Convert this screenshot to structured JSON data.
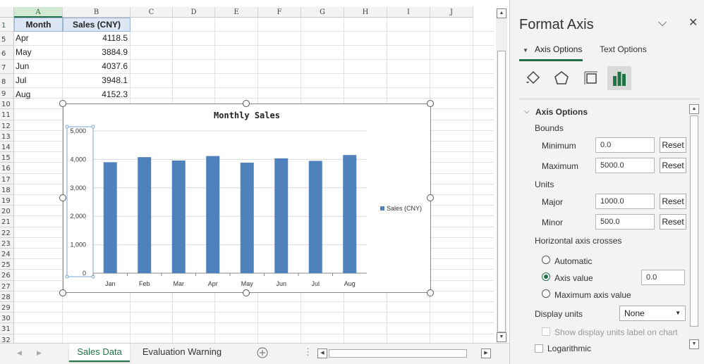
{
  "sheet": {
    "columns": [
      "A",
      "B",
      "C",
      "D",
      "E",
      "F",
      "G",
      "H",
      "I",
      "J"
    ],
    "rows": [
      "1",
      "5",
      "6",
      "7",
      "8",
      "9",
      "10",
      "11",
      "12",
      "13",
      "14",
      "15",
      "16",
      "17",
      "18",
      "19",
      "20",
      "21",
      "22",
      "23",
      "24",
      "25",
      "26",
      "27",
      "28",
      "29",
      "30",
      "31",
      "32"
    ],
    "header": {
      "month": "Month",
      "sales": "Sales (CNY)"
    },
    "data": [
      {
        "month": "Apr",
        "sales": "4118.5"
      },
      {
        "month": "May",
        "sales": "3884.9"
      },
      {
        "month": "Jun",
        "sales": "4037.6"
      },
      {
        "month": "Jul",
        "sales": "3948.1"
      },
      {
        "month": "Aug",
        "sales": "4152.3"
      }
    ]
  },
  "chart_data": {
    "type": "bar",
    "title": "Monthly Sales",
    "categories": [
      "Jan",
      "Feb",
      "Mar",
      "Apr",
      "May",
      "Jun",
      "Jul",
      "Aug"
    ],
    "series": [
      {
        "name": "Sales (CNY)",
        "values": [
          3900,
          4080,
          3960,
          4118.5,
          3884.9,
          4037.6,
          3948.1,
          4152.3
        ],
        "color": "#4f81bd"
      }
    ],
    "y_ticks": [
      "0",
      "1,000",
      "2,000",
      "3,000",
      "4,000",
      "5,000"
    ],
    "ylim": [
      0,
      5000
    ],
    "legend_position": "right",
    "grid": true
  },
  "tabs": {
    "active": "Sales Data",
    "other": "Evaluation Warning",
    "add_icon": "plus-circle-icon"
  },
  "pane": {
    "title": "Format Axis",
    "tab_axis": "Axis Options",
    "tab_text": "Text Options",
    "section": "Axis Options",
    "bounds_label": "Bounds",
    "minimum_label": "Minimum",
    "minimum_value": "0.0",
    "maximum_label": "Maximum",
    "maximum_value": "5000.0",
    "units_label": "Units",
    "major_label": "Major",
    "major_value": "1000.0",
    "minor_label": "Minor",
    "minor_value": "500.0",
    "reset_label": "Reset",
    "crosses_label": "Horizontal axis crosses",
    "automatic_label": "Automatic",
    "axis_value_label": "Axis value",
    "axis_value": "0.0",
    "maximum_axis_label": "Maximum axis value",
    "display_units_label": "Display units",
    "display_units_value": "None",
    "show_units_label": "Show display units label on chart",
    "logarithmic_label": "Logarithmic",
    "accent": "#217346"
  }
}
